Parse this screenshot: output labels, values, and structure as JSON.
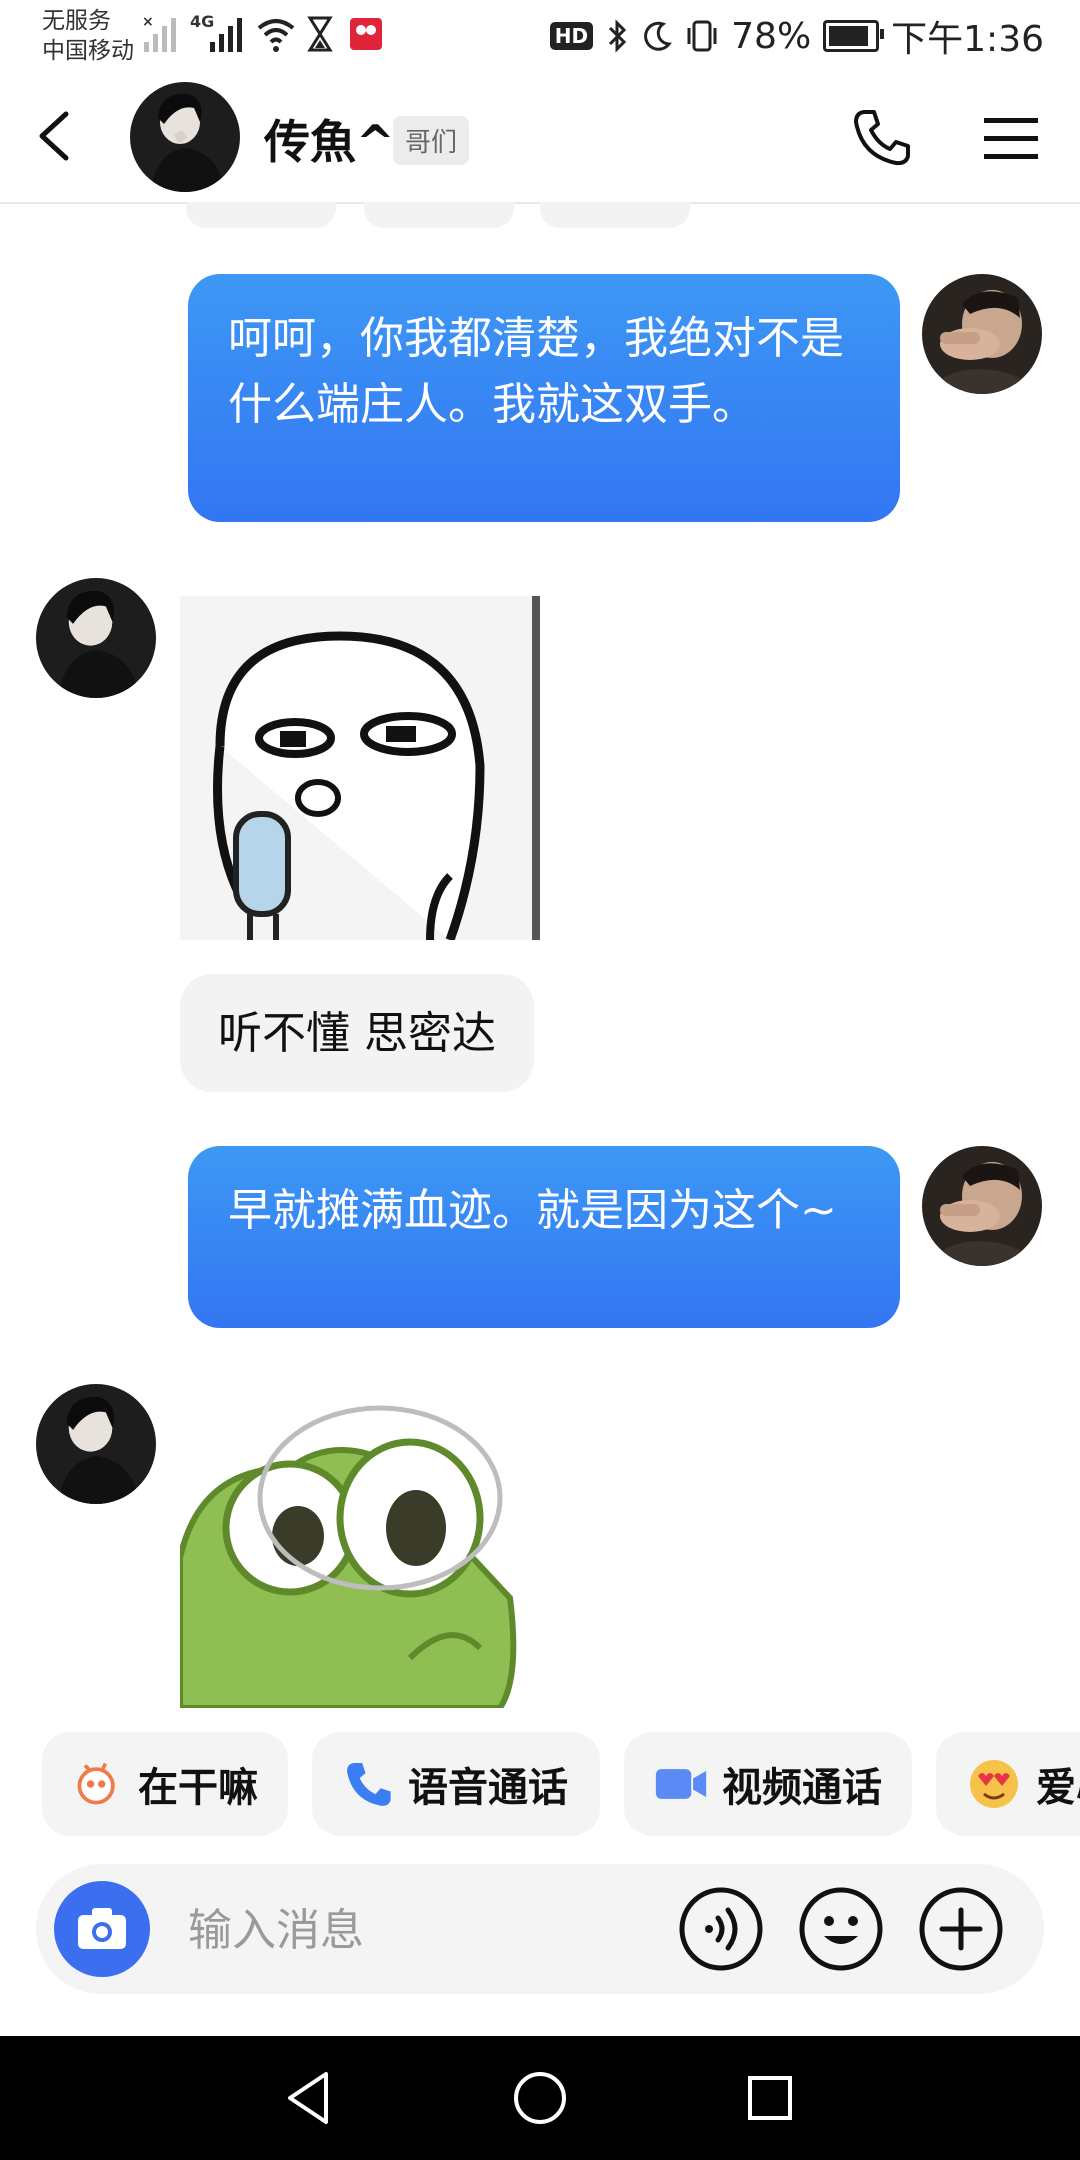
{
  "status_bar": {
    "carrier_line1": "无服务",
    "carrier_line2": "中国移动",
    "network": "4G",
    "hd_badge": "HD",
    "battery": "78%",
    "time": "下午1:36"
  },
  "header": {
    "name": "传魚^",
    "tag": "哥们"
  },
  "messages": [
    {
      "side": "out",
      "type": "text",
      "text": "呵呵，你我都清楚，我绝对不是什么端庄人。我就这双手。"
    },
    {
      "side": "in",
      "type": "sticker",
      "sticker": "doodle-face-sticker"
    },
    {
      "side": "in",
      "type": "text",
      "text": "听不懂 思密达"
    },
    {
      "side": "out",
      "type": "text",
      "text": "早就摊满血迹。就是因为这个~"
    },
    {
      "side": "in",
      "type": "sticker",
      "sticker": "green-frog-sticker"
    }
  ],
  "quick_actions": [
    {
      "label": "在干嘛",
      "icon": "chat-bubble-icon"
    },
    {
      "label": "语音通话",
      "icon": "phone-icon"
    },
    {
      "label": "视频通话",
      "icon": "video-camera-icon"
    },
    {
      "label": "爱心",
      "icon": "heart-eyes-emoji-icon"
    }
  ],
  "input": {
    "placeholder": "输入消息"
  },
  "colors": {
    "accent": "#3375f2",
    "bubble_out_top": "#3d98f5",
    "bubble_in": "#f3f3f3",
    "chip_bg": "#f4f4f4",
    "navbar": "#000000"
  }
}
